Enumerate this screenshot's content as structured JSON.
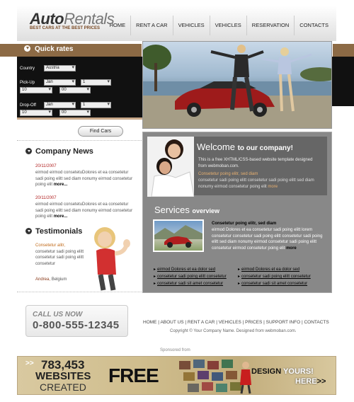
{
  "logo": {
    "name_auto": "Auto",
    "name_rentals": "Rentals",
    "tagline": "BEST CARS AT THE BEST PRICES"
  },
  "nav": [
    "HOME",
    "RENT A CAR",
    "VEHICLES",
    "VEHICLES",
    "RESERVATION",
    "CONTACTS"
  ],
  "quick_rates": {
    "title": "Quick rates",
    "country_label": "Country",
    "country_value": "Austria",
    "pickup_label": "Pick-Up",
    "pickup_month": "Jan",
    "pickup_day": "1",
    "pickup_hour": "10",
    "pickup_min": "00",
    "dropoff_label": "Drop-Off",
    "dropoff_month": "Jan",
    "dropoff_day": "1",
    "dropoff_hour": "10",
    "dropoff_min": "00",
    "button": "Find Cars"
  },
  "news": {
    "title": "Company News",
    "items": [
      {
        "date": "20/11/2007",
        "text": "eirmod eirmod consetetuDolores et ea consetetur sadi poing elitt sed diam nonumy eirmod consetetur poing elit",
        "more": "more..."
      },
      {
        "date": "20/11/2007",
        "text": "eirmod eirmod consetetuDolores et ea consetetur sadi poing elitt sed diam nonumy eirmod consetetur poing elit",
        "more": "more..."
      }
    ]
  },
  "testimonials": {
    "title": "Testimonials",
    "text_first": "Consetetur alitr,",
    "text_rest": "consetetur sadi poing elitt consetetur sadi poing elitt consetetur",
    "author": "Andrea,",
    "location": "Belgium"
  },
  "welcome": {
    "title_big": "Welcome",
    "title_small": "to our company!",
    "intro": "This is a free XHTML/CSS-based website template designed from webmoban.com.",
    "orange": "Consetetur poing elitr, sed diam",
    "gray": "consetetur sadi poing elitt consetetur sadi poing elitt sed diam nonumy eirmod consetetur poing elit",
    "more": "more"
  },
  "services": {
    "title_big": "Services",
    "title_small": "overview",
    "text_bold": "Consetetur poing elitr, sed diam",
    "text_white": "eirmod Dolores et ea consetetur sadi poing elitt lorem consetetur consetetur sadi poing elitt consetetur sadi poing elitt sed diam nonumy eirmod consetetur sadi poing elitt consetetur eirmod consetetur poing elit",
    "more": "more",
    "links_left": [
      "eirmod Dolores et ea dolor sed",
      "consetetur sadi poing elitt consetetur",
      "consetetur sadi sit amet consetetur"
    ],
    "links_right": [
      "eirmod Dolores et ea dolor sed",
      "consetetur sadi poing elitt consetetur",
      "consetetur sadi sit amet consetetur"
    ]
  },
  "footer": {
    "call_label": "CALL US NOW",
    "phone": "0-800-555-12345",
    "links": "HOME | ABOUT US | RENT A CAR | VEHICLES | PRICES | SUPPORT INFO | CONTACTS",
    "copyright": "Copyright © Your Company Name. Designed from webmoban.com.",
    "sponsored": "Sponsored from"
  },
  "banner": {
    "count": "783,453",
    "websites": "WEBSITES",
    "created": "CREATED",
    "free": "FREE",
    "design": "DESIGN",
    "yours": "YOURS!",
    "here": "HERE",
    "arrows_left": ">>",
    "arrows_right": ">>"
  },
  "colors": {
    "brown_band": "#8c6a45",
    "panel_dark": "#111111",
    "right_panel": "#888888",
    "news_date": "#b02020",
    "car_red": "#9e1b1b"
  }
}
